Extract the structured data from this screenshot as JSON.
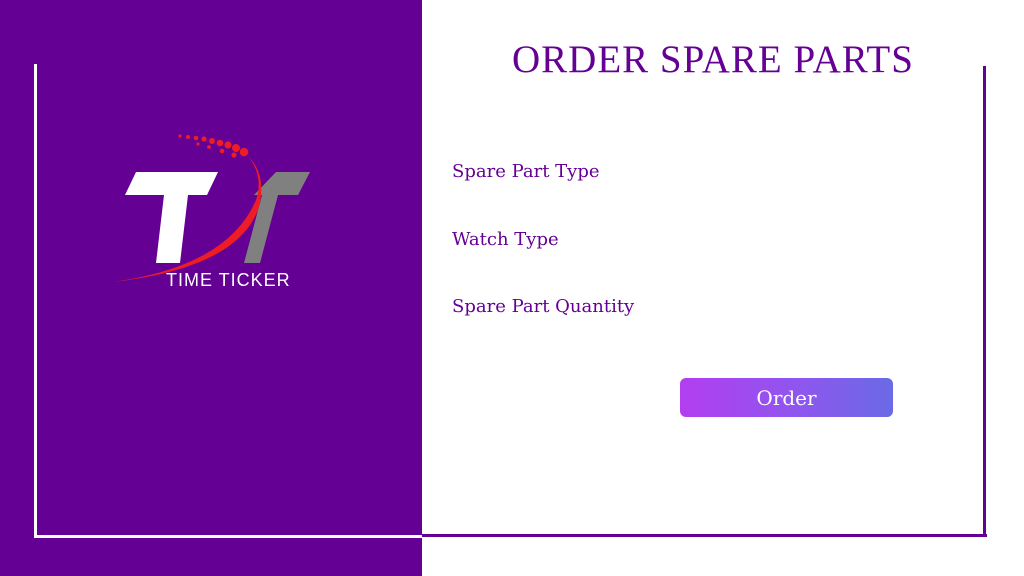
{
  "brand": {
    "logo_icon": "time-ticker-tt-logo",
    "name": "TIME TICKER"
  },
  "page": {
    "title": "ORDER SPARE PARTS"
  },
  "form": {
    "spare_part_type_label": "Spare Part Type",
    "watch_type_label": "Watch Type",
    "spare_part_quantity_label": "Spare Part Quantity",
    "order_button_label": "Order"
  },
  "colors": {
    "brand_purple": "#640093",
    "panel_background": "#ffffff",
    "logo_red": "#ee1c25",
    "logo_gray": "#808080",
    "button_gradient_start": "#b23ef0",
    "button_gradient_end": "#6a6ae6"
  }
}
